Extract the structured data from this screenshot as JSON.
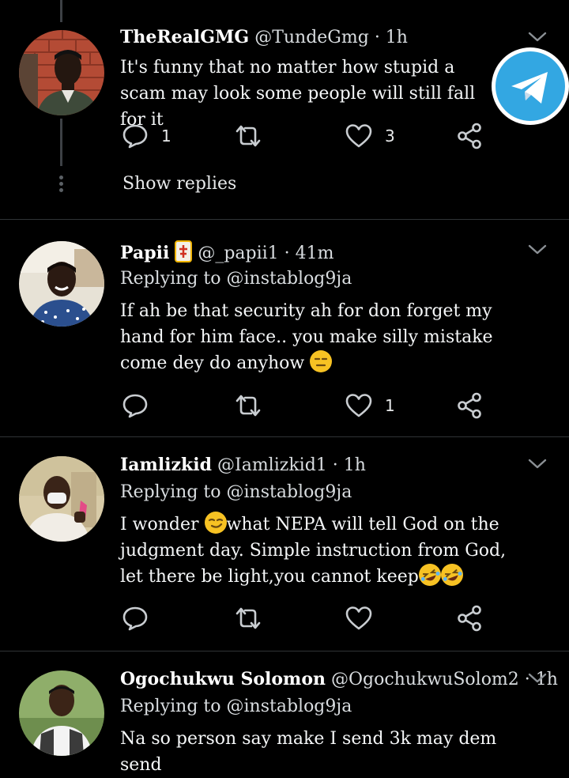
{
  "tweets": [
    {
      "name": "TheRealGMG",
      "meta": "@TundeGmg · 1h",
      "body": "It's funny that no matter how stupid a scam may look some people will still fall for it",
      "reply_count": "1",
      "like_count": "3",
      "show_replies": "Show replies"
    },
    {
      "name": "Papii",
      "meta": "@_papii1 · 41m",
      "replying": "Replying to @instablog9ja",
      "body": "If ah be that security ah for don forget my hand for him face.. you make silly mistake come dey do anyhow",
      "like_count": "1"
    },
    {
      "name": "Iamlizkid",
      "meta": "@Iamlizkid1 · 1h",
      "replying": "Replying to @instablog9ja",
      "body_a": "I wonder ",
      "body_b": "what NEPA will tell God on the judgment day. Simple instruction from God, let there be light,you cannot keep"
    },
    {
      "name": "Ogochukwu Solomon",
      "meta": "@OgochukwuSolom2 · 1h",
      "replying": "Replying to @instablog9ja",
      "body": "Na so person say make I send 3k may dem send"
    }
  ],
  "colors": {
    "background": "#000000",
    "divider": "#2f3336",
    "telegram": "#33a7e2"
  },
  "icons": [
    "reply-icon",
    "retweet-icon",
    "like-icon",
    "share-icon",
    "chevron-down-icon",
    "telegram-icon"
  ]
}
